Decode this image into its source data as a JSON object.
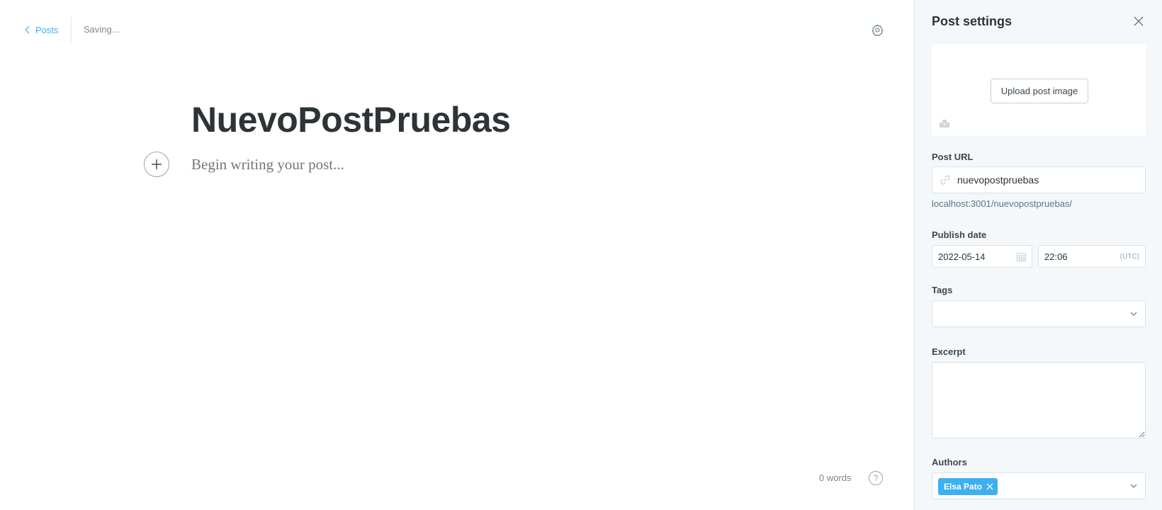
{
  "editor": {
    "back_label": "Posts",
    "status": "Saving...",
    "title": "NuevoPostPruebas",
    "body_placeholder": "Begin writing your post...",
    "word_count": "0 words",
    "help_label": "?"
  },
  "settings": {
    "title": "Post settings",
    "upload_label": "Upload post image",
    "url_label": "Post URL",
    "url_value": "nuevopostpruebas",
    "url_hint": "localhost:3001/nuevopostpruebas/",
    "publish_label": "Publish date",
    "date_value": "2022-05-14",
    "time_value": "22:06",
    "timezone": "(UTC)",
    "tags_label": "Tags",
    "excerpt_label": "Excerpt",
    "authors_label": "Authors",
    "authors": [
      {
        "name": "Elsa Pato"
      }
    ]
  },
  "colors": {
    "accent": "#3eb0ef",
    "panel_bg": "#f4f8fb",
    "title_text": "#2d3436"
  },
  "icons": [
    "chevron-left-icon",
    "gear-icon",
    "plus-icon",
    "help-icon",
    "close-icon",
    "image-icon",
    "link-icon",
    "calendar-icon",
    "chevron-down-icon",
    "token-remove-icon"
  ]
}
